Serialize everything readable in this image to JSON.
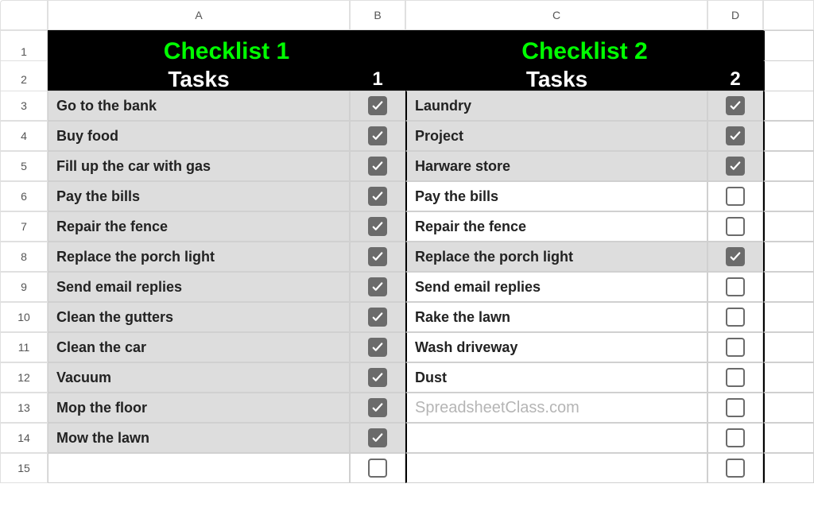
{
  "columns": [
    "A",
    "B",
    "C",
    "D"
  ],
  "rows": [
    1,
    2,
    3,
    4,
    5,
    6,
    7,
    8,
    9,
    10,
    11,
    12,
    13,
    14,
    15
  ],
  "checklist1": {
    "title": "Checklist 1",
    "tasks_header": "Tasks",
    "num_header": "1",
    "items": [
      {
        "task": "Go to the bank",
        "checked": true,
        "filled": true
      },
      {
        "task": "Buy food",
        "checked": true,
        "filled": true
      },
      {
        "task": "Fill up the car with gas",
        "checked": true,
        "filled": true
      },
      {
        "task": "Pay the bills",
        "checked": true,
        "filled": true
      },
      {
        "task": "Repair the fence",
        "checked": true,
        "filled": true
      },
      {
        "task": "Replace the porch light",
        "checked": true,
        "filled": true
      },
      {
        "task": "Send email replies",
        "checked": true,
        "filled": true
      },
      {
        "task": "Clean the gutters",
        "checked": true,
        "filled": true
      },
      {
        "task": "Clean the car",
        "checked": true,
        "filled": true
      },
      {
        "task": "Vacuum",
        "checked": true,
        "filled": true
      },
      {
        "task": "Mop the floor",
        "checked": true,
        "filled": true
      },
      {
        "task": "Mow the lawn",
        "checked": true,
        "filled": true
      },
      {
        "task": "",
        "checked": false,
        "filled": false
      }
    ]
  },
  "checklist2": {
    "title": "Checklist 2",
    "tasks_header": "Tasks",
    "num_header": "2",
    "items": [
      {
        "task": "Laundry",
        "checked": true,
        "filled": true
      },
      {
        "task": "Project",
        "checked": true,
        "filled": true
      },
      {
        "task": "Harware store",
        "checked": true,
        "filled": true
      },
      {
        "task": "Pay the bills",
        "checked": false,
        "filled": false
      },
      {
        "task": "Repair the fence",
        "checked": false,
        "filled": false
      },
      {
        "task": "Replace the porch light",
        "checked": true,
        "filled": true
      },
      {
        "task": "Send email replies",
        "checked": false,
        "filled": false
      },
      {
        "task": "Rake the lawn",
        "checked": false,
        "filled": false
      },
      {
        "task": "Wash driveway",
        "checked": false,
        "filled": false
      },
      {
        "task": "Dust",
        "checked": false,
        "filled": false
      },
      {
        "task": "",
        "checked": false,
        "filled": false,
        "watermark": "SpreadsheetClass.com"
      },
      {
        "task": "",
        "checked": false,
        "filled": false
      },
      {
        "task": "",
        "checked": false,
        "filled": false
      }
    ]
  },
  "watermark_text": "SpreadsheetClass.com"
}
